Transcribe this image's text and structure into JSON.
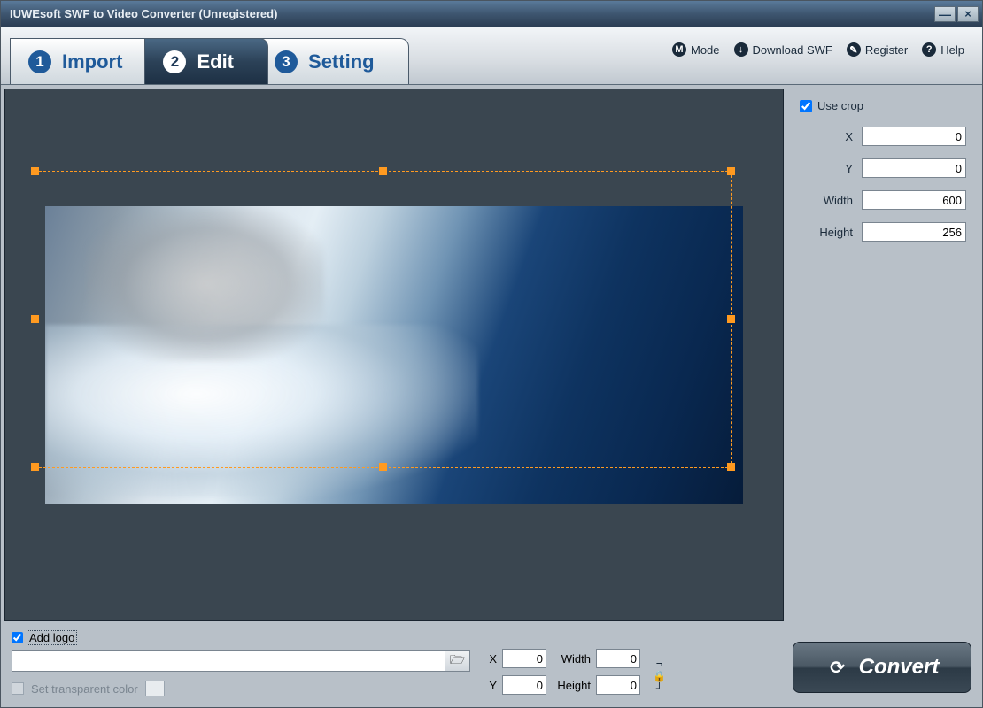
{
  "window": {
    "title": "IUWEsoft SWF to Video Converter (Unregistered)"
  },
  "tabs": {
    "import": {
      "num": "1",
      "label": "Import"
    },
    "edit": {
      "num": "2",
      "label": "Edit"
    },
    "setting": {
      "num": "3",
      "label": "Setting"
    }
  },
  "toolbar": {
    "mode": "Mode",
    "download": "Download SWF",
    "register": "Register",
    "help": "Help"
  },
  "crop": {
    "use_crop_label": "Use crop",
    "use_crop_checked": true,
    "x_label": "X",
    "x": "0",
    "y_label": "Y",
    "y": "0",
    "w_label": "Width",
    "w": "600",
    "h_label": "Height",
    "h": "256"
  },
  "logo": {
    "add_logo_label": "Add logo",
    "add_logo_checked": true,
    "path": "",
    "transparent_label": "Set transparent color",
    "x_label": "X",
    "x": "0",
    "y_label": "Y",
    "y": "0",
    "w_label": "Width",
    "w": "0",
    "h_label": "Height",
    "h": "0"
  },
  "convert": {
    "label": "Convert"
  }
}
